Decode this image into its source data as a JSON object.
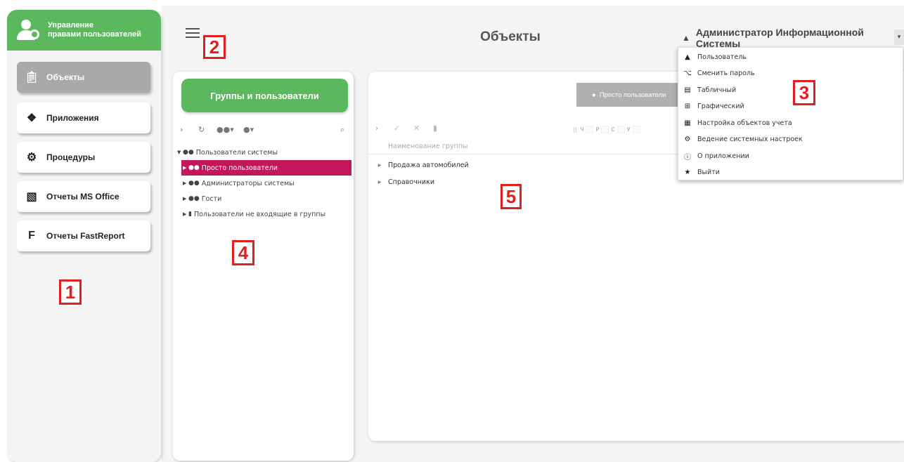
{
  "app": {
    "title_line1": "Управление",
    "title_line2": "правами пользователей",
    "brand_color": "#5cb85c"
  },
  "sidebar": {
    "items": [
      {
        "label": "Объекты",
        "icon": "clipboard-icon",
        "active": true
      },
      {
        "label": "Приложения",
        "icon": "dropbox-icon",
        "active": false
      },
      {
        "label": "Процедуры",
        "icon": "gear-icon",
        "active": false
      },
      {
        "label": "Отчеты MS Office",
        "icon": "office-icon",
        "active": false
      },
      {
        "label": "Отчеты FastReport",
        "icon": "fastreport-icon",
        "active": false
      }
    ]
  },
  "header": {
    "page_title": "Объекты",
    "user_name": "Администратор Информационной Системы"
  },
  "groups_panel": {
    "button_label": "Группы и пользователи",
    "tree": {
      "root": "Пользователи системы",
      "children": [
        {
          "label": "Просто пользователи",
          "selected": true
        },
        {
          "label": "Администраторы системы",
          "selected": false
        },
        {
          "label": "Гости",
          "selected": false
        },
        {
          "label": "Пользователи не входящие в группы",
          "selected": false
        }
      ]
    }
  },
  "main_panel": {
    "selected_group_button": "Просто пользователи",
    "rights_labels": [
      "Ч",
      "Р",
      "С",
      "У"
    ],
    "column_header": "Наименование группы",
    "rows": [
      "Продажа автомобилей",
      "Справочники"
    ]
  },
  "user_dropdown": {
    "items": [
      {
        "label": "Пользователь",
        "icon": "user-icon"
      },
      {
        "label": "Сменить пароль",
        "icon": "key-icon"
      },
      {
        "label": "Табличный",
        "icon": "table-icon"
      },
      {
        "label": "Графический",
        "icon": "grid-icon"
      },
      {
        "label": "Настройка объектов учета",
        "icon": "document-settings-icon"
      },
      {
        "label": "Ведение системных настроек",
        "icon": "settings-search-icon"
      },
      {
        "label": "О приложении",
        "icon": "info-icon"
      },
      {
        "label": "Выйти",
        "icon": "logout-runner-icon"
      }
    ]
  },
  "annotations": [
    "1",
    "2",
    "3",
    "4",
    "5"
  ]
}
